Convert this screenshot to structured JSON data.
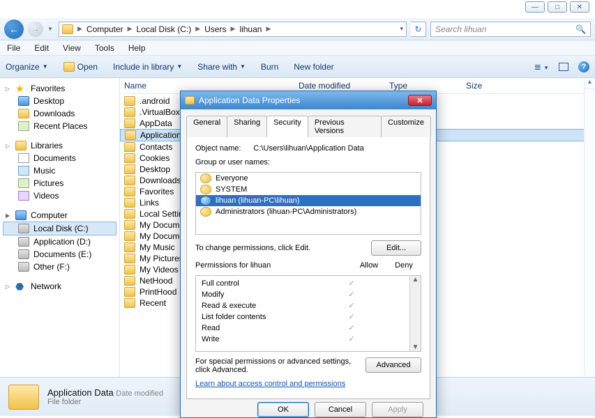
{
  "window_controls": {
    "min": "—",
    "max": "□",
    "close": "✕"
  },
  "address": {
    "segments": [
      "Computer",
      "Local Disk (C:)",
      "Users",
      "lihuan"
    ],
    "dropdown_glyph": "▾",
    "refresh_glyph": "↻"
  },
  "search": {
    "placeholder": "Search lihuan",
    "glyph": "🔍"
  },
  "menu": {
    "file": "File",
    "edit": "Edit",
    "view": "View",
    "tools": "Tools",
    "help": "Help"
  },
  "toolbar": {
    "organize": "Organize",
    "open": "Open",
    "include": "Include in library",
    "share": "Share with",
    "burn": "Burn",
    "newfolder": "New folder"
  },
  "columns": {
    "name": "Name",
    "date": "Date modified",
    "type": "Type",
    "size": "Size"
  },
  "sidebar": {
    "favorites": {
      "label": "Favorites",
      "items": [
        {
          "icon": "mon",
          "label": "Desktop"
        },
        {
          "icon": "folder",
          "label": "Downloads"
        },
        {
          "icon": "pic",
          "label": "Recent Places"
        }
      ]
    },
    "libraries": {
      "label": "Libraries",
      "items": [
        {
          "icon": "doc",
          "label": "Documents"
        },
        {
          "icon": "mus",
          "label": "Music"
        },
        {
          "icon": "pic",
          "label": "Pictures"
        },
        {
          "icon": "vid",
          "label": "Videos"
        }
      ]
    },
    "computer": {
      "label": "Computer",
      "items": [
        {
          "icon": "drive",
          "label": "Local Disk (C:)",
          "sel": true
        },
        {
          "icon": "drive",
          "label": "Application (D:)"
        },
        {
          "icon": "drive",
          "label": "Documents (E:)"
        },
        {
          "icon": "drive",
          "label": "Other (F:)"
        }
      ]
    },
    "network": {
      "label": "Network"
    }
  },
  "files": [
    {
      "label": ".android"
    },
    {
      "label": ".VirtualBox"
    },
    {
      "label": "AppData"
    },
    {
      "label": "Application Data",
      "sel": true
    },
    {
      "label": "Contacts"
    },
    {
      "label": "Cookies"
    },
    {
      "label": "Desktop"
    },
    {
      "label": "Downloads"
    },
    {
      "label": "Favorites"
    },
    {
      "label": "Links"
    },
    {
      "label": "Local Settings"
    },
    {
      "label": "My Documents"
    },
    {
      "label": "My Documents"
    },
    {
      "label": "My Music"
    },
    {
      "label": "My Pictures"
    },
    {
      "label": "My Videos"
    },
    {
      "label": "NetHood"
    },
    {
      "label": "PrintHood"
    },
    {
      "label": "Recent"
    }
  ],
  "status": {
    "name": "Application Data",
    "sub1": "Date modified",
    "sub2": "File folder"
  },
  "dialog": {
    "title": "Application Data Properties",
    "tabs": {
      "general": "General",
      "sharing": "Sharing",
      "security": "Security",
      "prev": "Previous Versions",
      "cust": "Customize"
    },
    "object_name_label": "Object name:",
    "object_name": "C:\\Users\\lihuan\\Application Data",
    "group_label": "Group or user names:",
    "groups": [
      {
        "icon": "grp",
        "label": "Everyone"
      },
      {
        "icon": "grp",
        "label": "SYSTEM"
      },
      {
        "icon": "usr",
        "label": "lihuan (lihuan-PC\\lihuan)",
        "sel": true
      },
      {
        "icon": "grp",
        "label": "Administrators (lihuan-PC\\Administrators)"
      }
    ],
    "edit_hint": "To change permissions, click Edit.",
    "edit_btn": "Edit...",
    "perm_label": "Permissions for lihuan",
    "allow": "Allow",
    "deny": "Deny",
    "perms": [
      {
        "name": "Full control",
        "allow": true,
        "deny": false
      },
      {
        "name": "Modify",
        "allow": true,
        "deny": false
      },
      {
        "name": "Read & execute",
        "allow": true,
        "deny": false
      },
      {
        "name": "List folder contents",
        "allow": true,
        "deny": false
      },
      {
        "name": "Read",
        "allow": true,
        "deny": false
      },
      {
        "name": "Write",
        "allow": true,
        "deny": false
      }
    ],
    "adv_hint": "For special permissions or advanced settings, click Advanced.",
    "adv_btn": "Advanced",
    "learn_link": "Learn about access control and permissions",
    "ok": "OK",
    "cancel": "Cancel",
    "apply": "Apply"
  }
}
